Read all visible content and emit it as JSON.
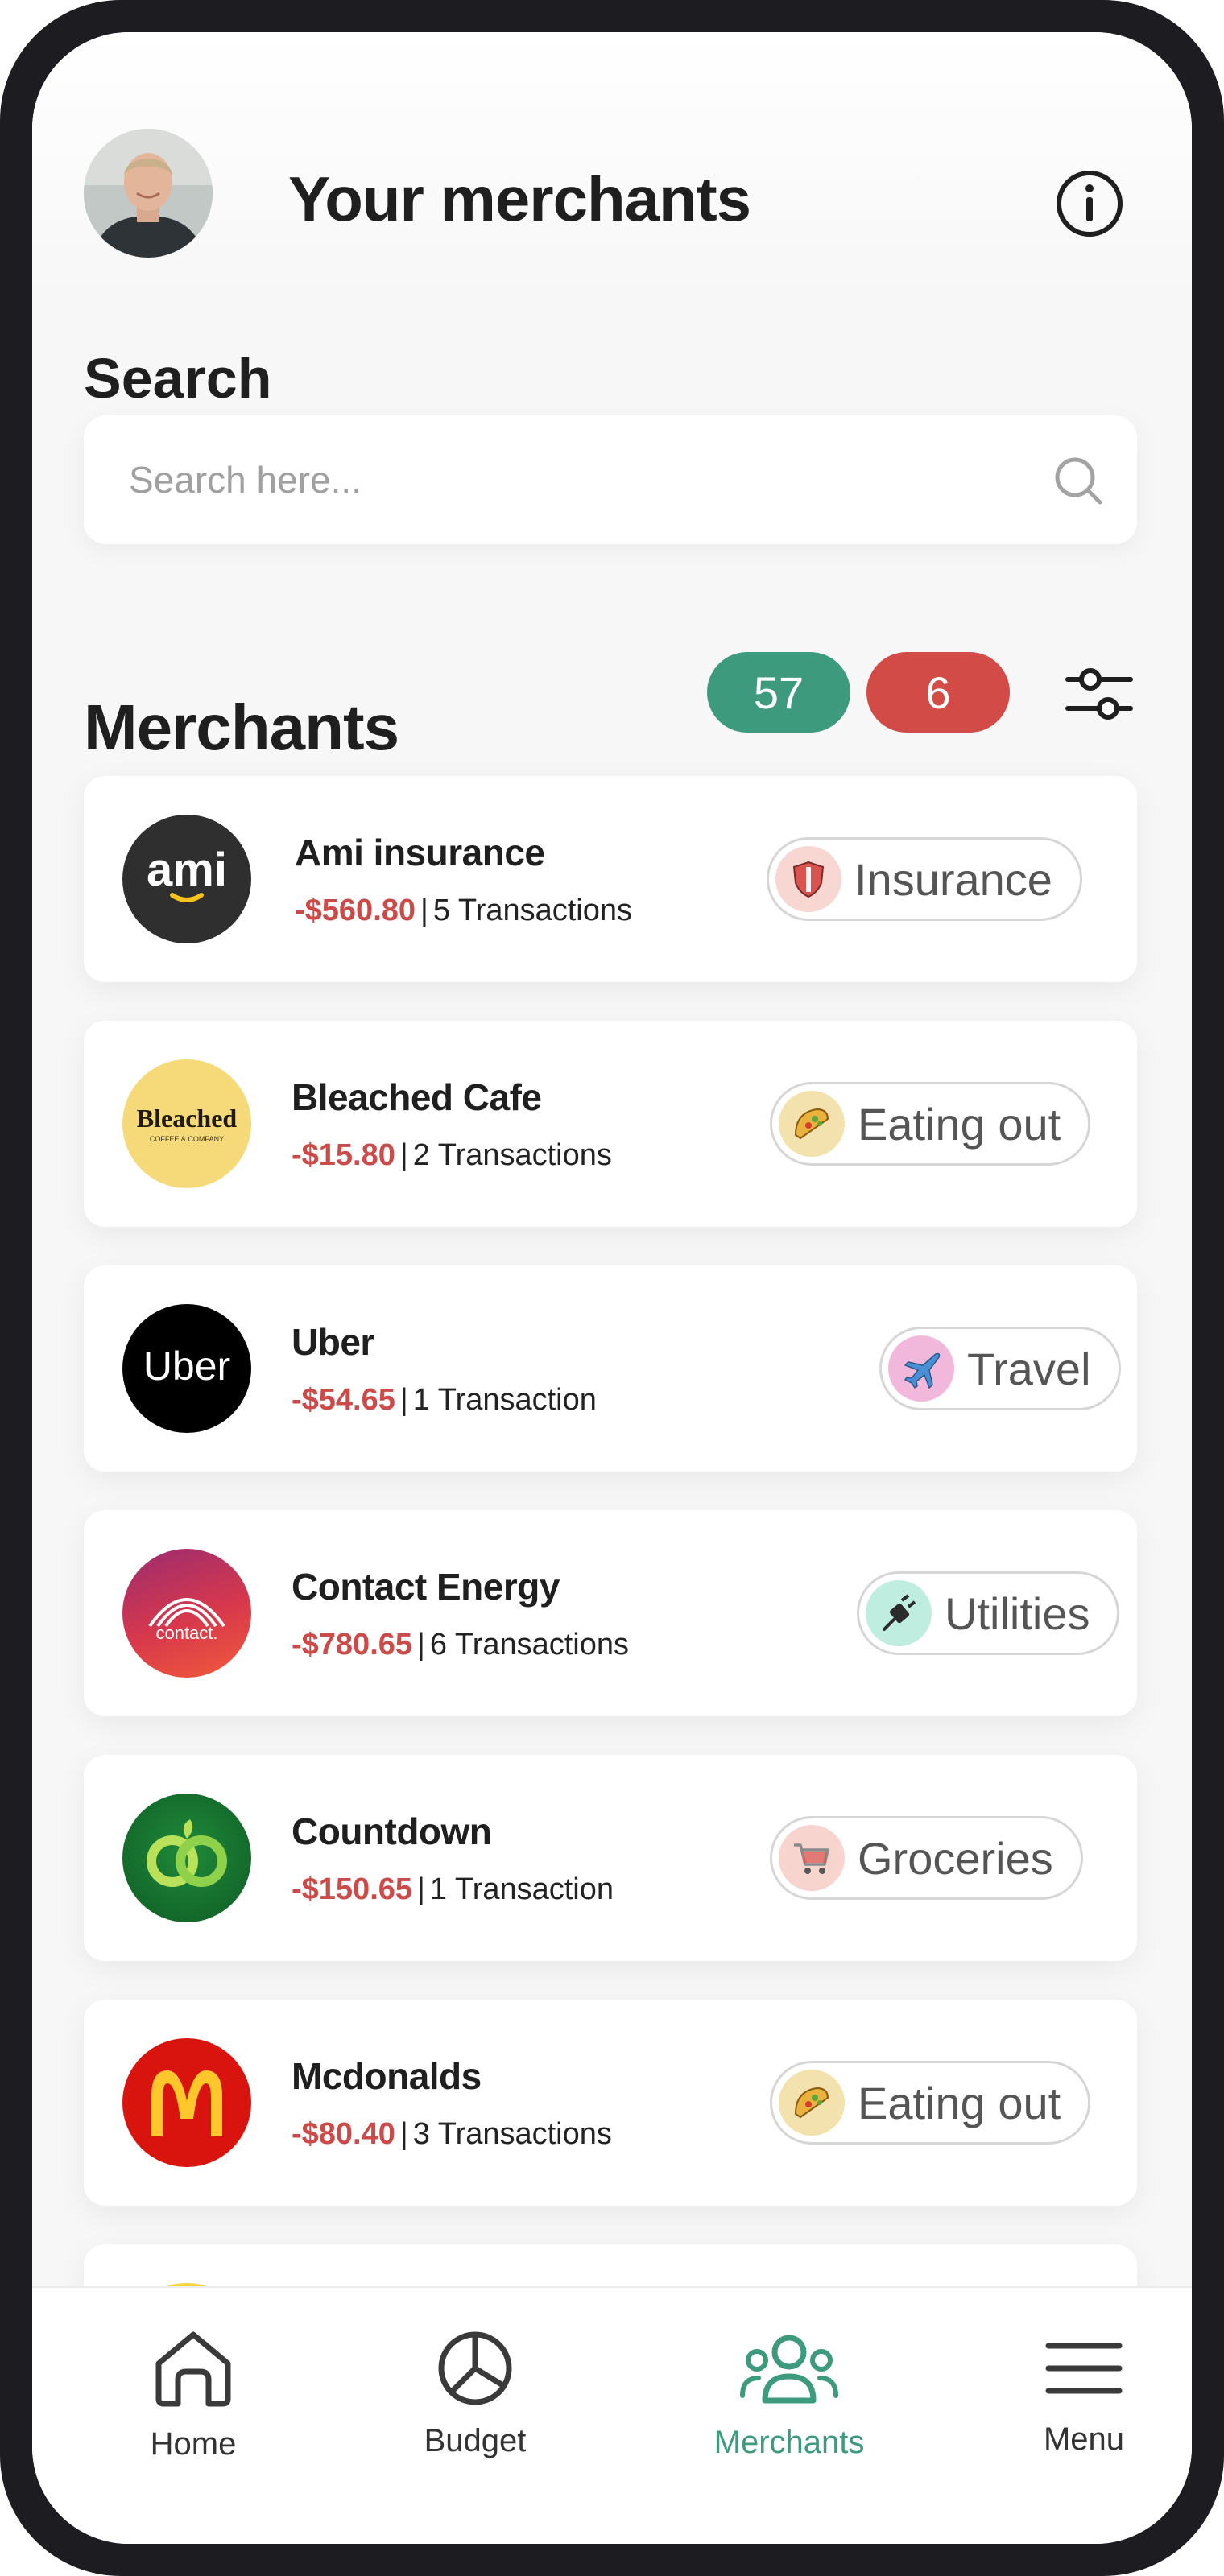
{
  "header": {
    "title": "Your merchants",
    "avatar_icon": "user-avatar",
    "info_icon": "info-icon"
  },
  "search": {
    "label": "Search",
    "placeholder": "Search here...",
    "icon": "search-icon"
  },
  "merchants_section": {
    "label": "Merchants",
    "count_green": "57",
    "count_red": "6",
    "filter_icon": "sliders-icon"
  },
  "merchants": [
    {
      "name": "Ami insurance",
      "amount": "-$560.80",
      "transactions": "5 Transactions",
      "category": "Insurance",
      "category_icon": "shield-icon",
      "logo_text": "ami"
    },
    {
      "name": "Bleached Cafe",
      "amount": "-$15.80",
      "transactions": "2 Transactions",
      "category": "Eating out",
      "category_icon": "taco-icon",
      "logo_text": "Bleached",
      "logo_subtext": "COFFEE & COMPANY"
    },
    {
      "name": "Uber",
      "amount": "-$54.65",
      "transactions": "1 Transaction",
      "category": "Travel",
      "category_icon": "airplane-icon",
      "logo_text": "Uber"
    },
    {
      "name": "Contact Energy",
      "amount": "-$780.65",
      "transactions": "6 Transactions",
      "category": "Utilities",
      "category_icon": "plug-icon",
      "logo_text": "contact."
    },
    {
      "name": "Countdown",
      "amount": "-$150.65",
      "transactions": "1 Transaction",
      "category": "Groceries",
      "category_icon": "cart-icon"
    },
    {
      "name": "Mcdonalds",
      "amount": "-$80.40",
      "transactions": "3 Transactions",
      "category": "Eating out",
      "category_icon": "taco-icon"
    }
  ],
  "nav": [
    {
      "label": "Home",
      "icon": "home-icon"
    },
    {
      "label": "Budget",
      "icon": "pie-chart-icon"
    },
    {
      "label": "Merchants",
      "icon": "people-icon",
      "active": true
    },
    {
      "label": "Menu",
      "icon": "menu-icon"
    }
  ],
  "colors": {
    "accent_green": "#3d9a7d",
    "accent_red": "#d24b47",
    "amount_red": "#cc4a48"
  }
}
